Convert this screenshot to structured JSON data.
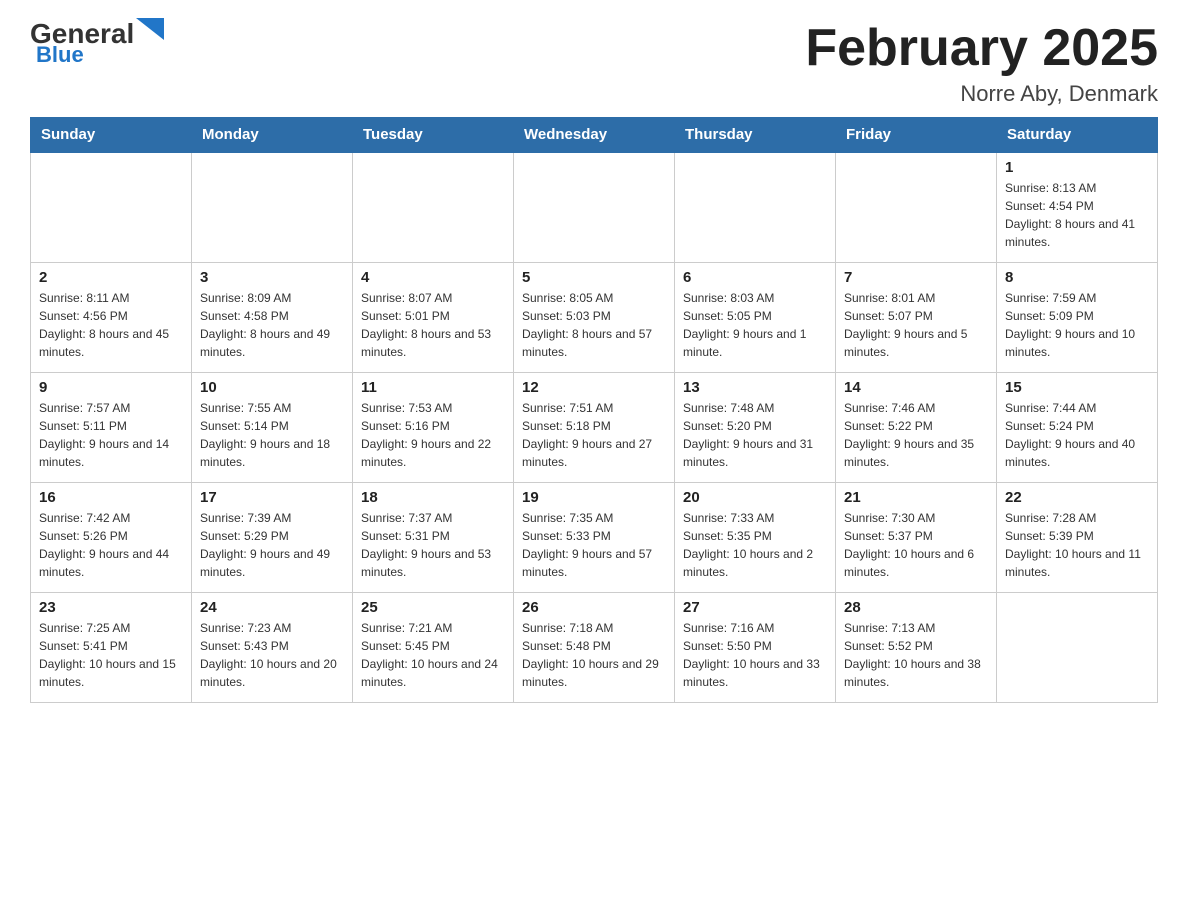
{
  "header": {
    "logo_main": "General",
    "logo_sub": "Blue",
    "month_title": "February 2025",
    "location": "Norre Aby, Denmark"
  },
  "weekdays": [
    "Sunday",
    "Monday",
    "Tuesday",
    "Wednesday",
    "Thursday",
    "Friday",
    "Saturday"
  ],
  "weeks": [
    [
      {
        "day": "",
        "sunrise": "",
        "sunset": "",
        "daylight": ""
      },
      {
        "day": "",
        "sunrise": "",
        "sunset": "",
        "daylight": ""
      },
      {
        "day": "",
        "sunrise": "",
        "sunset": "",
        "daylight": ""
      },
      {
        "day": "",
        "sunrise": "",
        "sunset": "",
        "daylight": ""
      },
      {
        "day": "",
        "sunrise": "",
        "sunset": "",
        "daylight": ""
      },
      {
        "day": "",
        "sunrise": "",
        "sunset": "",
        "daylight": ""
      },
      {
        "day": "1",
        "sunrise": "Sunrise: 8:13 AM",
        "sunset": "Sunset: 4:54 PM",
        "daylight": "Daylight: 8 hours and 41 minutes."
      }
    ],
    [
      {
        "day": "2",
        "sunrise": "Sunrise: 8:11 AM",
        "sunset": "Sunset: 4:56 PM",
        "daylight": "Daylight: 8 hours and 45 minutes."
      },
      {
        "day": "3",
        "sunrise": "Sunrise: 8:09 AM",
        "sunset": "Sunset: 4:58 PM",
        "daylight": "Daylight: 8 hours and 49 minutes."
      },
      {
        "day": "4",
        "sunrise": "Sunrise: 8:07 AM",
        "sunset": "Sunset: 5:01 PM",
        "daylight": "Daylight: 8 hours and 53 minutes."
      },
      {
        "day": "5",
        "sunrise": "Sunrise: 8:05 AM",
        "sunset": "Sunset: 5:03 PM",
        "daylight": "Daylight: 8 hours and 57 minutes."
      },
      {
        "day": "6",
        "sunrise": "Sunrise: 8:03 AM",
        "sunset": "Sunset: 5:05 PM",
        "daylight": "Daylight: 9 hours and 1 minute."
      },
      {
        "day": "7",
        "sunrise": "Sunrise: 8:01 AM",
        "sunset": "Sunset: 5:07 PM",
        "daylight": "Daylight: 9 hours and 5 minutes."
      },
      {
        "day": "8",
        "sunrise": "Sunrise: 7:59 AM",
        "sunset": "Sunset: 5:09 PM",
        "daylight": "Daylight: 9 hours and 10 minutes."
      }
    ],
    [
      {
        "day": "9",
        "sunrise": "Sunrise: 7:57 AM",
        "sunset": "Sunset: 5:11 PM",
        "daylight": "Daylight: 9 hours and 14 minutes."
      },
      {
        "day": "10",
        "sunrise": "Sunrise: 7:55 AM",
        "sunset": "Sunset: 5:14 PM",
        "daylight": "Daylight: 9 hours and 18 minutes."
      },
      {
        "day": "11",
        "sunrise": "Sunrise: 7:53 AM",
        "sunset": "Sunset: 5:16 PM",
        "daylight": "Daylight: 9 hours and 22 minutes."
      },
      {
        "day": "12",
        "sunrise": "Sunrise: 7:51 AM",
        "sunset": "Sunset: 5:18 PM",
        "daylight": "Daylight: 9 hours and 27 minutes."
      },
      {
        "day": "13",
        "sunrise": "Sunrise: 7:48 AM",
        "sunset": "Sunset: 5:20 PM",
        "daylight": "Daylight: 9 hours and 31 minutes."
      },
      {
        "day": "14",
        "sunrise": "Sunrise: 7:46 AM",
        "sunset": "Sunset: 5:22 PM",
        "daylight": "Daylight: 9 hours and 35 minutes."
      },
      {
        "day": "15",
        "sunrise": "Sunrise: 7:44 AM",
        "sunset": "Sunset: 5:24 PM",
        "daylight": "Daylight: 9 hours and 40 minutes."
      }
    ],
    [
      {
        "day": "16",
        "sunrise": "Sunrise: 7:42 AM",
        "sunset": "Sunset: 5:26 PM",
        "daylight": "Daylight: 9 hours and 44 minutes."
      },
      {
        "day": "17",
        "sunrise": "Sunrise: 7:39 AM",
        "sunset": "Sunset: 5:29 PM",
        "daylight": "Daylight: 9 hours and 49 minutes."
      },
      {
        "day": "18",
        "sunrise": "Sunrise: 7:37 AM",
        "sunset": "Sunset: 5:31 PM",
        "daylight": "Daylight: 9 hours and 53 minutes."
      },
      {
        "day": "19",
        "sunrise": "Sunrise: 7:35 AM",
        "sunset": "Sunset: 5:33 PM",
        "daylight": "Daylight: 9 hours and 57 minutes."
      },
      {
        "day": "20",
        "sunrise": "Sunrise: 7:33 AM",
        "sunset": "Sunset: 5:35 PM",
        "daylight": "Daylight: 10 hours and 2 minutes."
      },
      {
        "day": "21",
        "sunrise": "Sunrise: 7:30 AM",
        "sunset": "Sunset: 5:37 PM",
        "daylight": "Daylight: 10 hours and 6 minutes."
      },
      {
        "day": "22",
        "sunrise": "Sunrise: 7:28 AM",
        "sunset": "Sunset: 5:39 PM",
        "daylight": "Daylight: 10 hours and 11 minutes."
      }
    ],
    [
      {
        "day": "23",
        "sunrise": "Sunrise: 7:25 AM",
        "sunset": "Sunset: 5:41 PM",
        "daylight": "Daylight: 10 hours and 15 minutes."
      },
      {
        "day": "24",
        "sunrise": "Sunrise: 7:23 AM",
        "sunset": "Sunset: 5:43 PM",
        "daylight": "Daylight: 10 hours and 20 minutes."
      },
      {
        "day": "25",
        "sunrise": "Sunrise: 7:21 AM",
        "sunset": "Sunset: 5:45 PM",
        "daylight": "Daylight: 10 hours and 24 minutes."
      },
      {
        "day": "26",
        "sunrise": "Sunrise: 7:18 AM",
        "sunset": "Sunset: 5:48 PM",
        "daylight": "Daylight: 10 hours and 29 minutes."
      },
      {
        "day": "27",
        "sunrise": "Sunrise: 7:16 AM",
        "sunset": "Sunset: 5:50 PM",
        "daylight": "Daylight: 10 hours and 33 minutes."
      },
      {
        "day": "28",
        "sunrise": "Sunrise: 7:13 AM",
        "sunset": "Sunset: 5:52 PM",
        "daylight": "Daylight: 10 hours and 38 minutes."
      },
      {
        "day": "",
        "sunrise": "",
        "sunset": "",
        "daylight": ""
      }
    ]
  ]
}
